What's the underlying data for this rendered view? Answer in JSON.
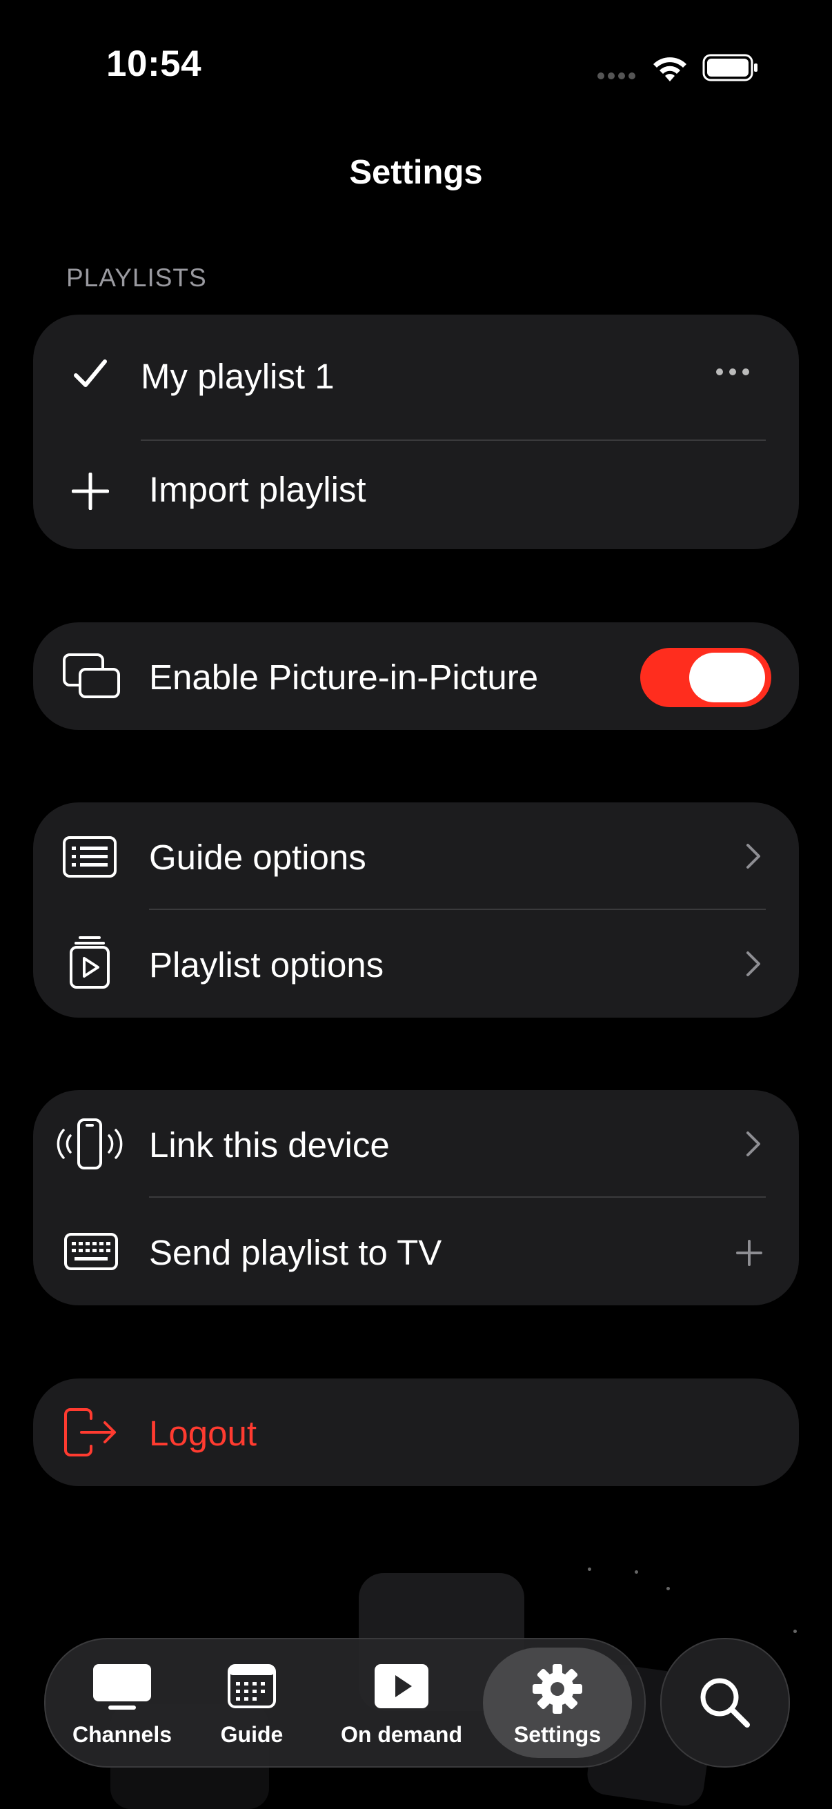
{
  "status": {
    "time": "10:54"
  },
  "header": {
    "title": "Settings"
  },
  "playlists": {
    "section_title": "PLAYLISTS",
    "current": "My playlist 1",
    "import_label": "Import playlist"
  },
  "pip": {
    "label": "Enable Picture-in-Picture",
    "enabled": true
  },
  "options": {
    "guide_label": "Guide options",
    "playlist_label": "Playlist options"
  },
  "devices": {
    "link_label": "Link this device",
    "send_label": "Send playlist to TV"
  },
  "logout": {
    "label": "Logout"
  },
  "tabbar": {
    "tabs": [
      {
        "label": "Channels",
        "icon": "tv-icon"
      },
      {
        "label": "Guide",
        "icon": "calendar-icon"
      },
      {
        "label": "On demand",
        "icon": "play-icon"
      },
      {
        "label": "Settings",
        "icon": "gear-icon",
        "selected": true
      }
    ],
    "search_icon": "search-icon"
  },
  "colors": {
    "accent": "#ff2d1e",
    "logout": "#ff3b30",
    "card": "#1c1c1e",
    "background": "#000000"
  }
}
